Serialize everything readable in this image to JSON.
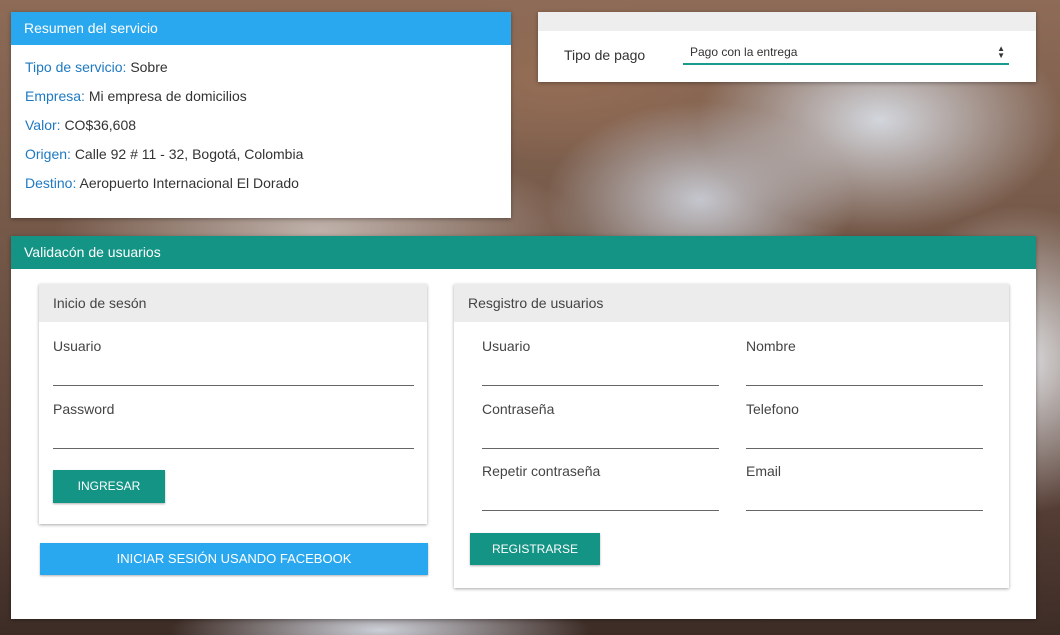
{
  "summary": {
    "header": "Resumen del servicio",
    "rows": [
      {
        "label": "Tipo de servicio:",
        "value": "Sobre"
      },
      {
        "label": "Empresa:",
        "value": "Mi empresa de domicilios"
      },
      {
        "label": "Valor:",
        "value": "CO$36,608"
      },
      {
        "label": "Origen:",
        "value": "Calle 92 # 11 - 32, Bogotá, Colombia"
      },
      {
        "label": "Destino:",
        "value": "Aeropuerto Internacional El Dorado"
      }
    ]
  },
  "payment": {
    "label": "Tipo de pago",
    "selected": "Pago con la entrega"
  },
  "validation": {
    "header": "Validacón de usuarios",
    "login": {
      "header": "Inicio de sesón",
      "user_label": "Usuario",
      "password_label": "Password",
      "submit_label": "INGRESAR",
      "facebook_label": "INICIAR SESIÓN USANDO FACEBOOK"
    },
    "register": {
      "header": "Resgistro de usuarios",
      "user_label": "Usuario",
      "name_label": "Nombre",
      "password_label": "Contraseña",
      "phone_label": "Telefono",
      "repeat_password_label": "Repetir contraseña",
      "email_label": "Email",
      "submit_label": "REGISTRARSE"
    }
  },
  "colors": {
    "summary_header": "#29a8f0",
    "validation_header": "#149485",
    "label_blue": "#1e79c2"
  }
}
